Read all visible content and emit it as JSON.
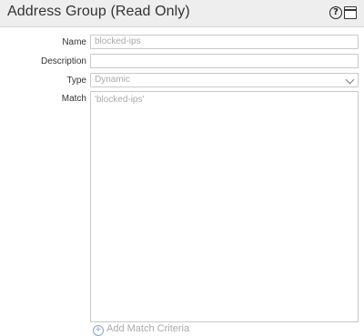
{
  "dialog": {
    "title": "Address Group (Read Only)",
    "help_icon": "help-icon",
    "window_icon": "window-icon"
  },
  "form": {
    "name_label": "Name",
    "name_value": "blocked-ips",
    "description_label": "Description",
    "description_value": "",
    "type_label": "Type",
    "type_value": "Dynamic",
    "match_label": "Match",
    "match_value": "'blocked-ips'",
    "add_match_label": "Add Match Criteria"
  }
}
